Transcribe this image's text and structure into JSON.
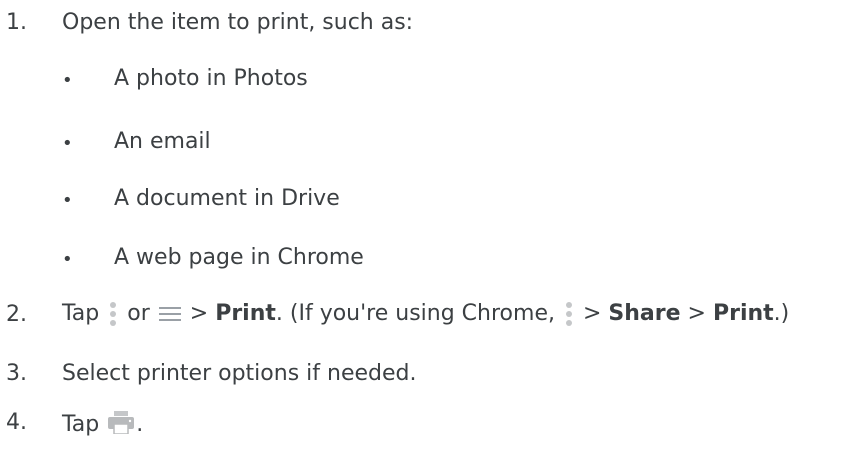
{
  "steps": [
    {
      "number": "1.",
      "text": "Open the item to print, such as:"
    },
    {
      "number": "2."
    },
    {
      "number": "3.",
      "text": "Select printer options if needed."
    },
    {
      "number": "4.",
      "text": "Tap"
    }
  ],
  "examples": [
    "A photo in Photos",
    "An email",
    "A document in Drive",
    "A web page in Chrome"
  ],
  "bullet": "•",
  "step2": {
    "tap": "Tap",
    "or": "or",
    "gt1": ">",
    "print": "Print",
    "after_print": ". (If you're using Chrome,",
    "gt2": ">",
    "share": "Share",
    "gt3": ">",
    "print2": "Print",
    "close": ".)"
  },
  "step4_end": ".",
  "icons": {
    "more": "more-vert-icon",
    "menu": "menu-icon",
    "print": "printer-icon"
  }
}
